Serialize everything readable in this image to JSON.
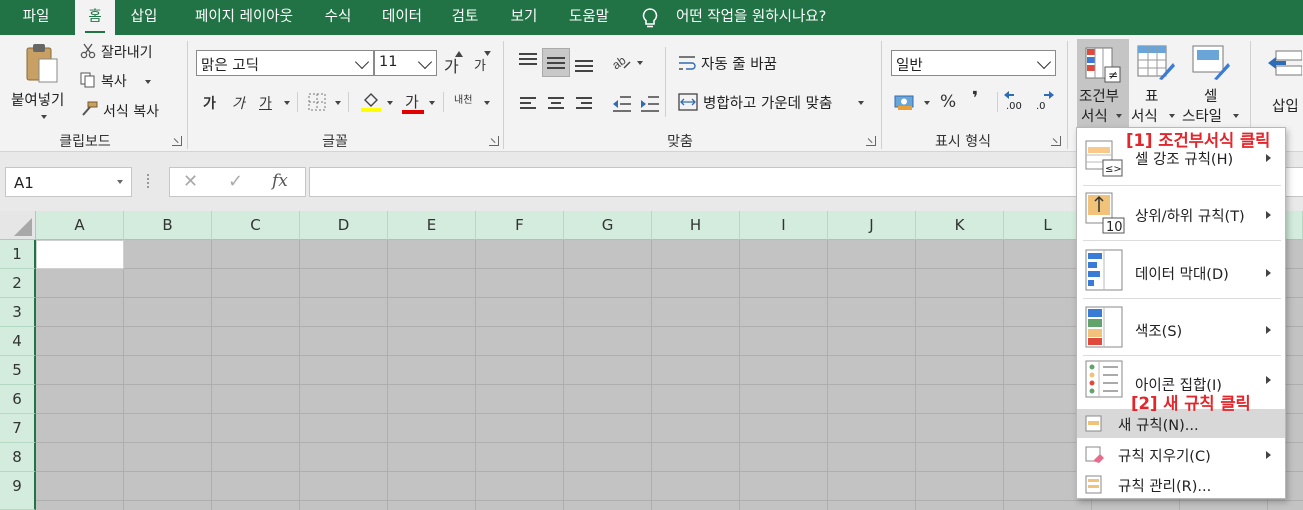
{
  "tabs": [
    "파일",
    "홈",
    "삽입",
    "페이지 레이아웃",
    "수식",
    "데이터",
    "검토",
    "보기",
    "도움말"
  ],
  "tell_me": "어떤 작업을 원하시나요?",
  "clipboard": {
    "paste": "붙여넣기",
    "cut": "잘라내기",
    "copy": "복사",
    "format_painter": "서식 복사",
    "group": "클립보드"
  },
  "font": {
    "name": "맑은 고딕",
    "size": "11",
    "grow": "가",
    "shrink": "가",
    "bold": "가",
    "italic": "가",
    "underline": "가",
    "font_color_glyph": "가",
    "phonetic": "내천",
    "group": "글꼴",
    "colors": {
      "highlight": "#ffff00",
      "font_color": "#e00000"
    }
  },
  "alignment": {
    "wrap": "자동 줄 바꿈",
    "merge": "병합하고 가운데 맞춤",
    "group": "맞춤"
  },
  "number": {
    "format": "일반",
    "percent": "%",
    "comma": "❜",
    "inc_decimal": ".00",
    "dec_decimal": ".0",
    "group": "표시 형식"
  },
  "styles": {
    "conditional_format": [
      "조건부",
      "서식"
    ],
    "format_table": [
      "표",
      "서식"
    ],
    "cell_styles": [
      "셀",
      "스타일"
    ]
  },
  "cells_group": {
    "insert": "삽입"
  },
  "name_box": "A1",
  "formula_icons": {
    "cancel": "✕",
    "enter": "✓",
    "fx": "fx"
  },
  "columns": [
    "A",
    "B",
    "C",
    "D",
    "E",
    "F",
    "G",
    "H",
    "I",
    "J",
    "K",
    "L"
  ],
  "rows": [
    "1",
    "2",
    "3",
    "4",
    "5",
    "6",
    "7",
    "8",
    "9"
  ],
  "menu": {
    "highlight": "셀 강조 규칙(H)",
    "topbottom": "상위/하위 규칙(T)",
    "databar": "데이터 막대(D)",
    "colorscale": "색조(S)",
    "iconset": "아이콘 집합(I)",
    "new_rule": "새 규칙(N)...",
    "clear_rules": "규칙 지우기(C)",
    "manage_rules": "규칙 관리(R)...",
    "icon_10": "10"
  },
  "annotations": {
    "step1": "[1] 조건부서식 클릭",
    "step2": "[2] 새 규칙 클릭"
  },
  "theme": {
    "excel_green": "#217346",
    "annotation_red": "#e2262b"
  }
}
